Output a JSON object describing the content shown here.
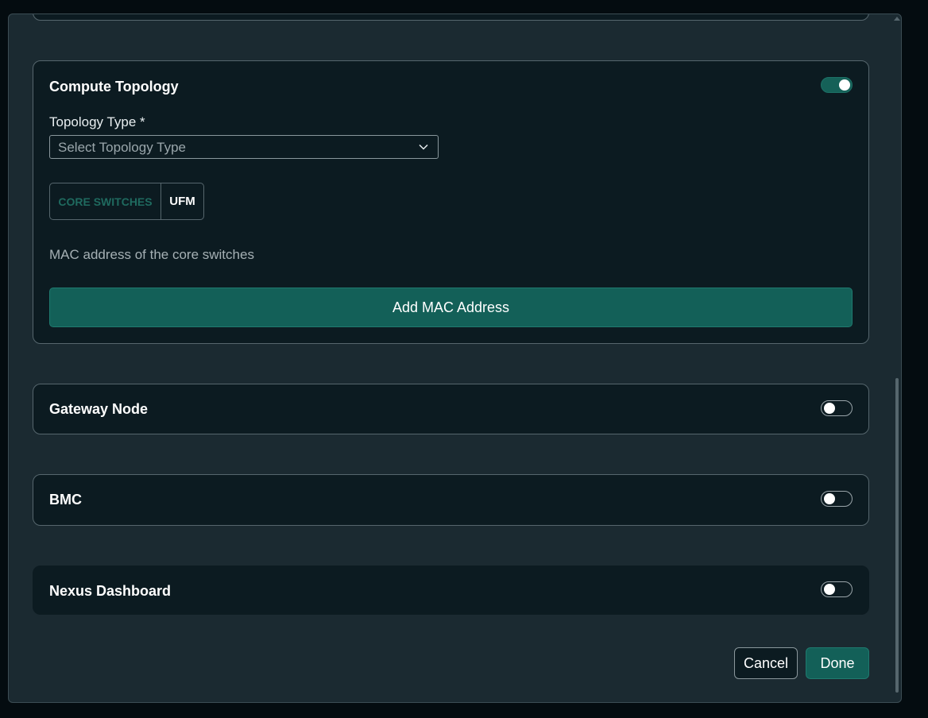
{
  "compute_topology": {
    "title": "Compute Topology",
    "toggle_on": true,
    "topology_type_label": "Topology Type *",
    "topology_type_placeholder": "Select Topology Type",
    "segments": [
      "CORE SWITCHES",
      "UFM"
    ],
    "active_segment": "UFM",
    "help_text": "MAC address of the core switches",
    "add_mac_label": "Add MAC Address"
  },
  "gateway_node": {
    "title": "Gateway Node",
    "toggle_on": false
  },
  "bmc": {
    "title": "BMC",
    "toggle_on": false
  },
  "nexus_dashboard": {
    "title": "Nexus Dashboard",
    "toggle_on": false
  },
  "footer": {
    "cancel_label": "Cancel",
    "done_label": "Done"
  },
  "colors": {
    "accent": "#136058",
    "background": "#1b2a31",
    "card": "#0c1b21"
  },
  "icons": {
    "select_chevron": "chevron-down-icon"
  }
}
